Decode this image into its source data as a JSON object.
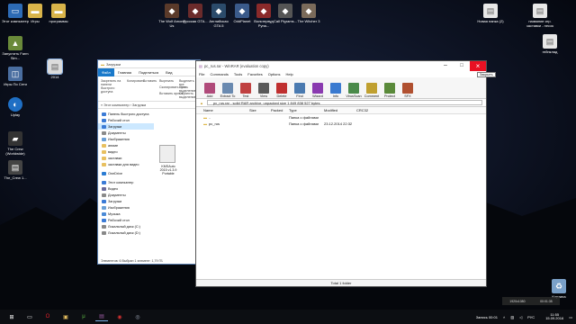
{
  "desktop": {
    "left_icons": [
      {
        "label": "Этот компьютер",
        "color": "#2d6bb5"
      },
      {
        "label": "Запустить Farm Sim...",
        "color": "#6a8a3a"
      },
      {
        "label": "Игры По Сети",
        "color": "#4a6ea0"
      },
      {
        "label": "Uplay",
        "color": "#1f6fc4"
      },
      {
        "label": "The Crew (Worldwide)",
        "color": "#333333"
      },
      {
        "label": "The_Crew 1...",
        "color": "#444444"
      }
    ],
    "top_icons": [
      {
        "label": "Игры",
        "color": "#d9b44a"
      },
      {
        "label": "программы",
        "color": "#d9b44a"
      },
      {
        "label": "The Wolf Among Us",
        "color": "#5a3a2a"
      },
      {
        "label": "Русская GTA...",
        "color": "#6b2b2b"
      },
      {
        "label": "Английская GTA 5",
        "color": "#2b4b6b"
      },
      {
        "label": "OddPlanet",
        "color": "#3a5a8a"
      },
      {
        "label": "Вольтервуд Руна...",
        "color": "#8a2a2a"
      },
      {
        "label": "Call Pigrams...",
        "color": "#555555"
      },
      {
        "label": "The Witcher 3",
        "color": "#7a6a5a"
      }
    ],
    "right_icons": [
      {
        "label": "Новая папка (2)",
        "color": "#e8e8e8"
      },
      {
        "label": "название игр. заставки - песок",
        "color": "#e8e8e8"
      },
      {
        "label": "гейнклад",
        "color": "#e8e8e8"
      }
    ],
    "selected_file_label": "2014",
    "recycle_bin_label": "Корзина"
  },
  "explorer": {
    "title": "Загрузки",
    "tabs": [
      "Файл",
      "Главная",
      "Поделиться",
      "Вид"
    ],
    "ribbon_items": [
      "Закрепить на панели быстрого доступа",
      "Копировать",
      "Вставить",
      "Вырезать",
      "Скопировать путь",
      "Вставить ярлык",
      "Выделить все",
      "Снять выделение",
      "Обратить выделение"
    ],
    "address": "« Этот компьютер › Загрузки",
    "nav": [
      {
        "label": "Панель быстрого доступа",
        "icon_color": "#3b7bd6",
        "selected": false
      },
      {
        "label": "Рабочий стол",
        "icon_color": "#3b7bd6",
        "selected": false
      },
      {
        "label": "Загрузки",
        "icon_color": "#3b7bd6",
        "selected": true
      },
      {
        "label": "Документы",
        "icon_color": "#8a8a8a",
        "selected": false
      },
      {
        "label": "Изображения",
        "icon_color": "#6a9fd6",
        "selected": false
      },
      {
        "label": "аниме",
        "icon_color": "#e8c060",
        "selected": false
      },
      {
        "label": "видео",
        "icon_color": "#e8c060",
        "selected": false
      },
      {
        "label": "заставки",
        "icon_color": "#e8c060",
        "selected": false
      },
      {
        "label": "заставки для видео",
        "icon_color": "#e8c060",
        "selected": false
      },
      {
        "label": "OneDrive",
        "icon_color": "#2b7cd3",
        "selected": false
      },
      {
        "label": "Этот компьютер",
        "icon_color": "#3b7bd6",
        "selected": false
      },
      {
        "label": "Видео",
        "icon_color": "#6a6a9a",
        "selected": false
      },
      {
        "label": "Документы",
        "icon_color": "#8a8a8a",
        "selected": false
      },
      {
        "label": "Загрузки",
        "icon_color": "#3b7bd6",
        "selected": false
      },
      {
        "label": "Изображения",
        "icon_color": "#6a9fd6",
        "selected": false
      },
      {
        "label": "Музыка",
        "icon_color": "#4a8ad6",
        "selected": false
      },
      {
        "label": "Рабочий стол",
        "icon_color": "#3b7bd6",
        "selected": false
      },
      {
        "label": "Локальный диск (C:)",
        "icon_color": "#888888",
        "selected": false
      },
      {
        "label": "Локальный диск (D:)",
        "icon_color": "#888888",
        "selected": false
      }
    ],
    "file_thumb_label": "KMSAuto 2015 v1.3.9 Portable",
    "status": "Элементов: 6   Выбран 1 элемент: 1,79 ГБ"
  },
  "winrar": {
    "title": "pc_rus.rar - WinRAR (evaluation copy)",
    "menu": [
      "File",
      "Commands",
      "Tools",
      "Favorites",
      "Options",
      "Help"
    ],
    "toolbar": [
      {
        "label": "Add",
        "color": "#b04a7a"
      },
      {
        "label": "Extract To",
        "color": "#6a8ab0"
      },
      {
        "label": "Test",
        "color": "#c04040"
      },
      {
        "label": "View",
        "color": "#5a5a5a"
      },
      {
        "label": "Delete",
        "color": "#c03030"
      },
      {
        "label": "Find",
        "color": "#4a7ab0"
      },
      {
        "label": "Wizard",
        "color": "#8a3ab0"
      },
      {
        "label": "Info",
        "color": "#3a7ad0"
      },
      {
        "label": "VirusScan",
        "color": "#4a8a4a"
      },
      {
        "label": "Comment",
        "color": "#c0a030"
      },
      {
        "label": "Protect",
        "color": "#5a8a3a"
      },
      {
        "label": "SFX",
        "color": "#b05030"
      }
    ],
    "path": "pc_rus.rar - solid RAR archive, unpacked size 1 849 838 527 bytes",
    "columns": [
      "Name",
      "Size",
      "Packed",
      "Type",
      "Modified",
      "CRC32"
    ],
    "rows": [
      {
        "name": "..",
        "size": "",
        "packed": "",
        "type": "Папка с файлами",
        "modified": "",
        "crc": ""
      },
      {
        "name": "pc_rus",
        "size": "",
        "packed": "",
        "type": "Папка с файлами",
        "modified": "23.12.2014 22:32",
        "crc": ""
      }
    ],
    "status": "Total 1 folder",
    "close_tooltip": "Закрыть"
  },
  "taskbar": {
    "items": [
      {
        "name": "start-button",
        "glyph": "⊞",
        "color": "#ffffff"
      },
      {
        "name": "task-view",
        "glyph": "▭",
        "color": "#ffffff"
      },
      {
        "name": "opera",
        "glyph": "O",
        "color": "#e0202a"
      },
      {
        "name": "folder",
        "glyph": "▣",
        "color": "#e8c060"
      },
      {
        "name": "utorrent",
        "glyph": "μ",
        "color": "#5ab043"
      },
      {
        "name": "winrar",
        "glyph": "▤",
        "color": "#9a5aa0"
      },
      {
        "name": "app-red",
        "glyph": "◉",
        "color": "#d03030"
      },
      {
        "name": "steam",
        "glyph": "◎",
        "color": "#9aa0b0"
      }
    ],
    "sysinfo": {
      "resolution": "1920x1080",
      "time_short": "00:01:35"
    },
    "tray": {
      "recording": "Запись 00:01",
      "lang": "РУС",
      "time": "11:55",
      "date": "15.09.2016"
    }
  }
}
